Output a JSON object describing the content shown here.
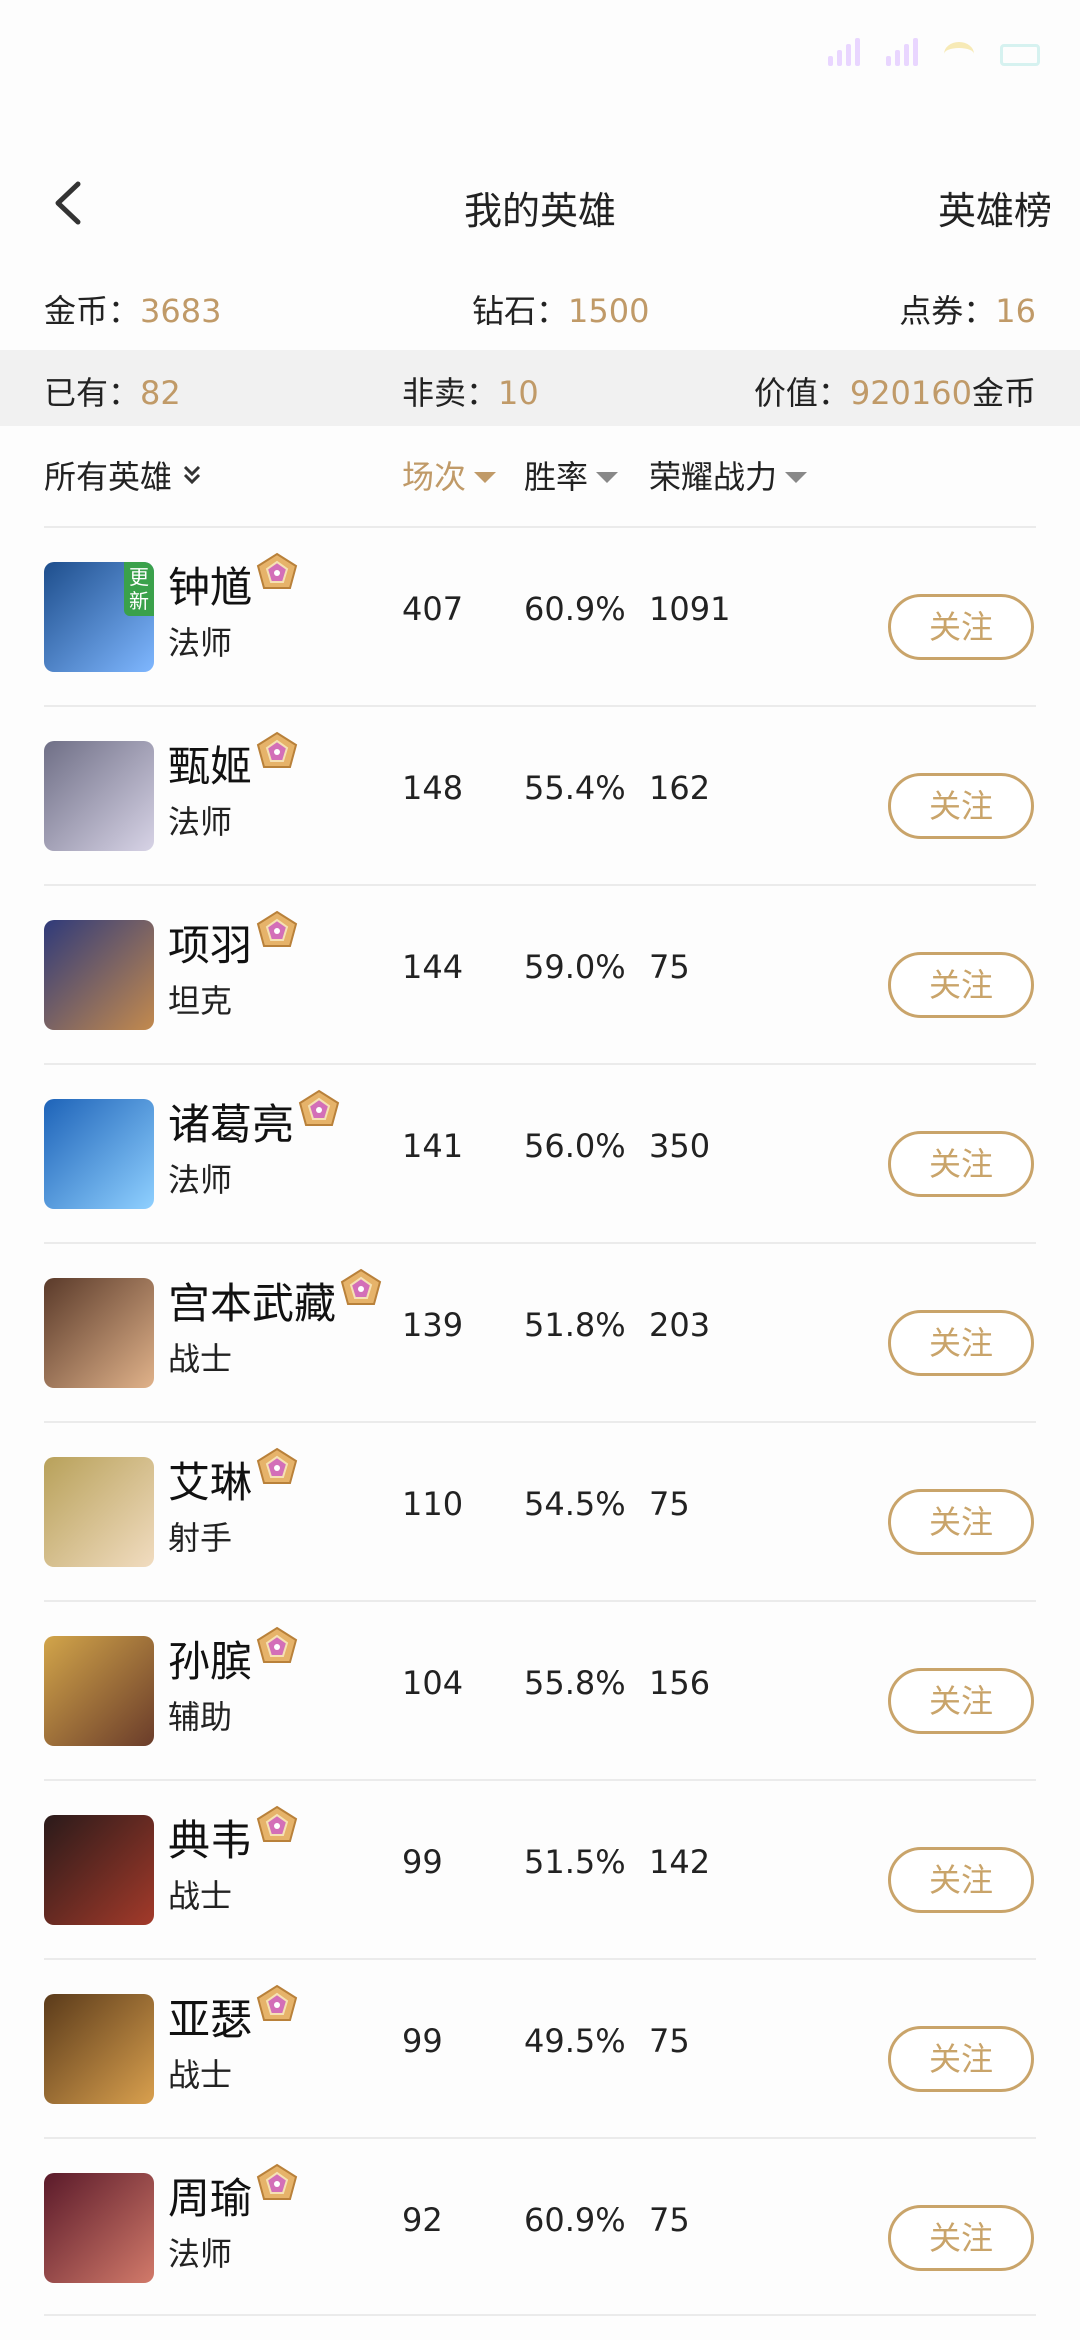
{
  "header": {
    "title": "我的英雄",
    "rank_link": "英雄榜"
  },
  "currency": {
    "gold_label": "金币：",
    "gold_value": "3683",
    "diamond_label": "钻石：",
    "diamond_value": "1500",
    "coupon_label": "点券：",
    "coupon_value": "16"
  },
  "summary": {
    "owned_label": "已有：",
    "owned_value": "82",
    "unsold_label": "非卖：",
    "unsold_value": "10",
    "worth_label": "价值：",
    "worth_value": "920160",
    "worth_unit": "金币"
  },
  "sort": {
    "filter_label": "所有英雄",
    "games_label": "场次",
    "winrate_label": "胜率",
    "power_label": "荣耀战力"
  },
  "heroes": [
    {
      "name": "钟馗",
      "role": "法师",
      "games": "407",
      "winrate": "60.9%",
      "power": "1091",
      "follow": "关注",
      "badge": "更新",
      "colors": [
        "#1e4e8c",
        "#7fb7ff"
      ]
    },
    {
      "name": "甄姬",
      "role": "法师",
      "games": "148",
      "winrate": "55.4%",
      "power": "162",
      "follow": "关注",
      "colors": [
        "#6f6f86",
        "#d7d3e6"
      ]
    },
    {
      "name": "项羽",
      "role": "坦克",
      "games": "144",
      "winrate": "59.0%",
      "power": "75",
      "follow": "关注",
      "colors": [
        "#2f3a7a",
        "#c38a4e"
      ]
    },
    {
      "name": "诸葛亮",
      "role": "法师",
      "games": "141",
      "winrate": "56.0%",
      "power": "350",
      "follow": "关注",
      "colors": [
        "#1e63b8",
        "#8fd0ff"
      ]
    },
    {
      "name": "宫本武藏",
      "role": "战士",
      "games": "139",
      "winrate": "51.8%",
      "power": "203",
      "follow": "关注",
      "colors": [
        "#5a3a2a",
        "#e0b28a"
      ]
    },
    {
      "name": "艾琳",
      "role": "射手",
      "games": "110",
      "winrate": "54.5%",
      "power": "75",
      "follow": "关注",
      "colors": [
        "#b8a15a",
        "#f1dcc0"
      ]
    },
    {
      "name": "孙膑",
      "role": "辅助",
      "games": "104",
      "winrate": "55.8%",
      "power": "156",
      "follow": "关注",
      "colors": [
        "#d2a54a",
        "#6a3c2a"
      ]
    },
    {
      "name": "典韦",
      "role": "战士",
      "games": "99",
      "winrate": "51.5%",
      "power": "142",
      "follow": "关注",
      "colors": [
        "#2a1a1a",
        "#a33a2a"
      ]
    },
    {
      "name": "亚瑟",
      "role": "战士",
      "games": "99",
      "winrate": "49.5%",
      "power": "75",
      "follow": "关注",
      "colors": [
        "#5a3a1a",
        "#d9a04e"
      ]
    },
    {
      "name": "周瑜",
      "role": "法师",
      "games": "92",
      "winrate": "60.9%",
      "power": "75",
      "follow": "关注",
      "colors": [
        "#5a1a2a",
        "#d27a6a"
      ]
    }
  ]
}
